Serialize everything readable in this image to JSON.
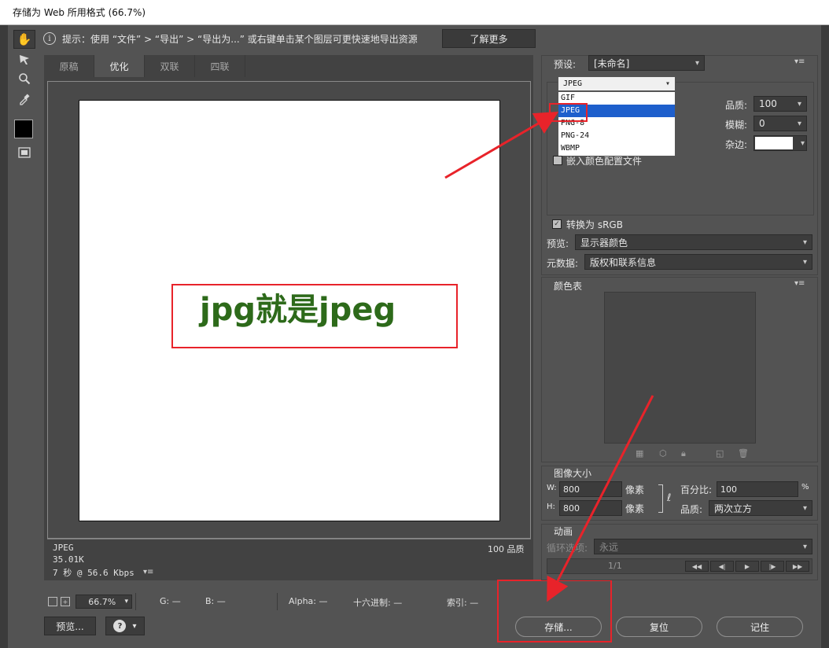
{
  "window": {
    "title": "存储为 Web 所用格式 (66.7%)"
  },
  "tip": {
    "text": "提示：使用 “文件” > “导出” > “导出为...” 或右键单击某个图层可更快速地导出资源",
    "learn_more": "了解更多"
  },
  "tabs": [
    {
      "label": "原稿",
      "active": false
    },
    {
      "label": "优化",
      "active": true
    },
    {
      "label": "双联",
      "active": false
    },
    {
      "label": "四联",
      "active": false
    }
  ],
  "canvas": {
    "annotation": "jpg就是jpeg"
  },
  "image_info": {
    "format": "JPEG",
    "size": "35.01K",
    "time": "7 秒 @ 56.6 Kbps",
    "quality_label": "100 品质"
  },
  "status": {
    "zoom": "66.7%",
    "g": "G: —",
    "b": "B: —",
    "alpha": "Alpha: —",
    "hex": "十六进制: —",
    "index": "索引: —"
  },
  "bottom": {
    "preview": "预览...",
    "save": "存储...",
    "reset": "复位",
    "remember": "记住"
  },
  "settings": {
    "preset_label": "预设:",
    "preset_value": "[未命名]",
    "format_value": "JPEG",
    "format_options": [
      "GIF",
      "JPEG",
      "PNG-8",
      "PNG-24",
      "WBMP"
    ],
    "quality_label": "品质:",
    "quality_value": "100",
    "blur_label": "模糊:",
    "blur_value": "0",
    "matte_label": "杂边:",
    "embed_profile": "嵌入颜色配置文件",
    "convert_srgb": "转换为 sRGB",
    "preview_label": "预览:",
    "preview_value": "显示器颜色",
    "metadata_label": "元数据:",
    "metadata_value": "版权和联系信息"
  },
  "color_table": {
    "title": "颜色表"
  },
  "image_size": {
    "title": "图像大小",
    "w_label": "W:",
    "w_value": "800",
    "w_unit": "像素",
    "h_label": "H:",
    "h_value": "800",
    "h_unit": "像素",
    "percent_label": "百分比:",
    "percent_value": "100",
    "percent_unit": "%",
    "quality_label": "品质:",
    "quality_value": "两次立方"
  },
  "animation": {
    "title": "动画",
    "loop_label": "循环选项:",
    "loop_value": "永远",
    "frame": "1/1"
  },
  "colors": {
    "accent_red": "#e8232a",
    "annotation_green": "#2d6a1a",
    "selection_blue": "#1e5fcc"
  }
}
